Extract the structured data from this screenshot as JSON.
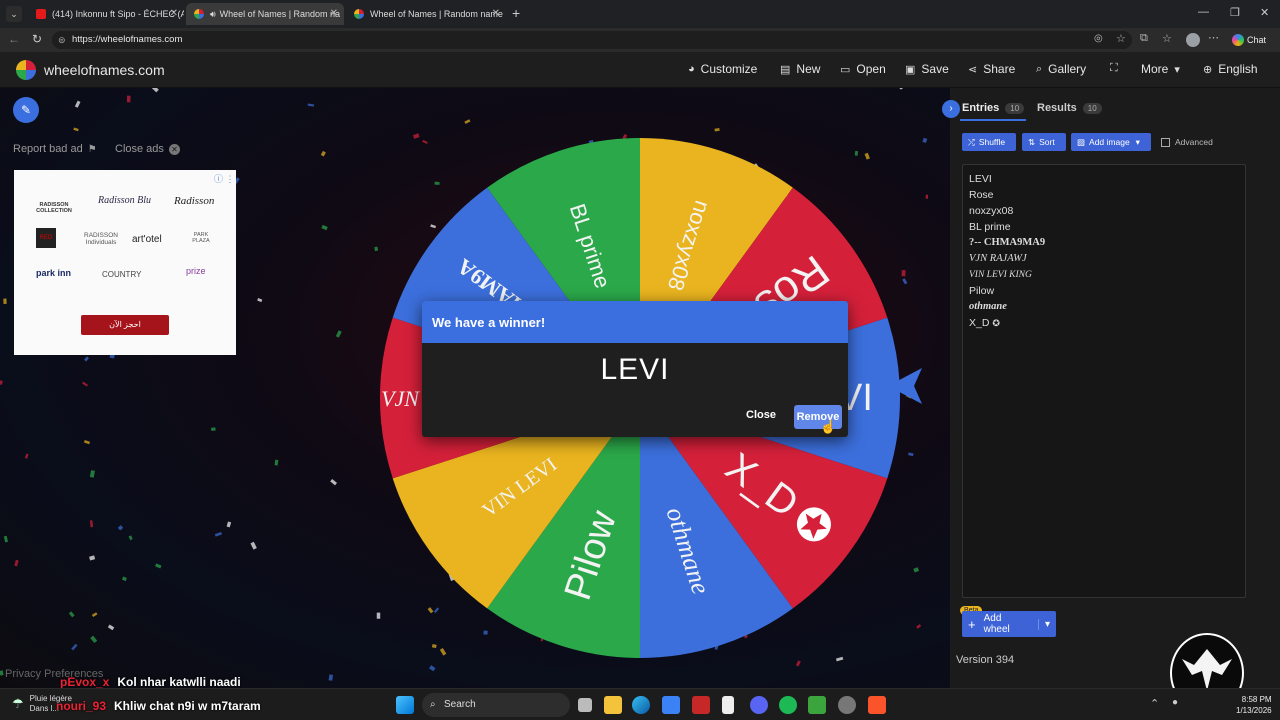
{
  "browser": {
    "tabs": [
      {
        "title": "(414) Inkonnu ft Sipo - ÉCHEC (AL",
        "icon_color": "#e21a1a"
      },
      {
        "title": "Wheel of Names | Random na",
        "icon_color": "#e0a823"
      },
      {
        "title": "Wheel of Names | Random name p",
        "icon_color": "#e0a823"
      }
    ],
    "url": "https://wheelofnames.com",
    "chat_label": "Chat"
  },
  "header": {
    "site_name": "wheelofnames.com",
    "nav": [
      {
        "label": "Customize",
        "icon": "palette-icon"
      },
      {
        "label": "New",
        "icon": "new-file-icon"
      },
      {
        "label": "Open",
        "icon": "folder-icon"
      },
      {
        "label": "Save",
        "icon": "save-icon"
      },
      {
        "label": "Share",
        "icon": "share-icon"
      },
      {
        "label": "Gallery",
        "icon": "search-icon"
      },
      {
        "label": "",
        "icon": "fullscreen-icon"
      },
      {
        "label": "More",
        "icon": "chevron-down-icon"
      },
      {
        "label": "English",
        "icon": "globe-icon"
      }
    ]
  },
  "ads": {
    "report_bad_ad": "Report bad ad",
    "close_ads": "Close ads",
    "brands": [
      "RADISSON COLLECTION",
      "Radisson Blu",
      "Radisson",
      "RED",
      "RADISSON Individuals",
      "art'otel",
      "PARK PLAZA",
      "park inn",
      "COUNTRY",
      "prize"
    ],
    "cta": "احجز الآن"
  },
  "wheel": {
    "segments": [
      {
        "label": "LEVI",
        "color": "#3c6fdc"
      },
      {
        "label": "X_D",
        "color": "#d5203a"
      },
      {
        "label": "othmane",
        "color": "#3c6fdc"
      },
      {
        "label": "Pilow",
        "color": "#2ba84a"
      },
      {
        "label": "VIN LEVI KING",
        "color": "#e9b41f"
      },
      {
        "label": "VJN RAJAWJ",
        "color": "#d5203a"
      },
      {
        "label": "CHMA9MA9",
        "color": "#3c6fdc"
      },
      {
        "label": "BL prime",
        "color": "#2ba84a"
      },
      {
        "label": "noxzyx08",
        "color": "#e9b41f"
      },
      {
        "label": "Rose",
        "color": "#d5203a"
      }
    ],
    "visible_text": {
      "levi": "VI",
      "x_d": "X_D",
      "othmane": "othmane",
      "pilow": "Pilow",
      "vin": "VIN LEVI",
      "vjn": "VJN",
      "chma": "...WHAM9A",
      "bl": "BL prime",
      "nox": "noxzyx08",
      "rose": "Rose"
    }
  },
  "modal": {
    "title": "We have a winner!",
    "winner": "LEVI",
    "close_label": "Close",
    "remove_label": "Remove"
  },
  "panel": {
    "tab_entries": "Entries",
    "entries_count": "10",
    "tab_results": "Results",
    "results_count": "10",
    "shuffle": "Shuffle",
    "sort": "Sort",
    "add_image": "Add image",
    "advanced": "Advanced",
    "entries": [
      "LEVI",
      "Rose",
      "noxzyx08",
      "BL prime",
      "?-- CHMA9MA9",
      "VJN RAJAWJ",
      "VIN LEVI KING",
      "Pilow",
      "othmane",
      "X_D"
    ],
    "beta": "Beta",
    "add_wheel": "Add wheel",
    "version": "Version 394"
  },
  "overlay": {
    "privacy": "Privacy Preferences",
    "chat1_user": "pEvox_x",
    "chat1_text": "Kol nhar katwlli naadi",
    "chat2_user": "nouri_93",
    "chat2_text": "Khliw chat n9i w m7taram"
  },
  "taskbar": {
    "weather_line1": "Pluie légère",
    "weather_line2": "Dans l...",
    "search": "Search",
    "time": "8:58 PM",
    "date": "1/13/2026"
  },
  "colors": {
    "accent": "#3b6fe0",
    "wheel_red": "#d5203a",
    "wheel_blue": "#3c6fdc",
    "wheel_green": "#2ba84a",
    "wheel_yellow": "#e9b41f"
  }
}
